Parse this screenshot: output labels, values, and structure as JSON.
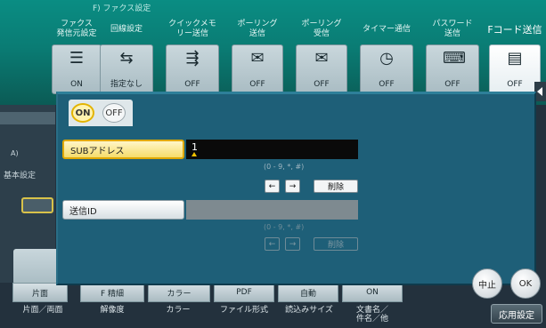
{
  "breadcrumb": "F) ファクス設定",
  "tabs": [
    {
      "label": "ファクス\n発信元設定",
      "value": "ON",
      "icon": "fax-header-icon",
      "active": false
    },
    {
      "label": "回線設定",
      "value": "指定なし",
      "icon": "line-icon",
      "active": false
    },
    {
      "label": "クイックメモ\nリー送信",
      "value": "OFF",
      "icon": "quick-memory-icon",
      "active": false
    },
    {
      "label": "ポーリング\n送信",
      "value": "OFF",
      "icon": "polling-send-icon",
      "active": false
    },
    {
      "label": "ポーリング\n受信",
      "value": "OFF",
      "icon": "polling-receive-icon",
      "active": false
    },
    {
      "label": "タイマー通信",
      "value": "OFF",
      "icon": "timer-icon",
      "active": false
    },
    {
      "label": "パスワード\n送信",
      "value": "OFF",
      "icon": "password-send-icon",
      "active": false
    },
    {
      "label": "Fコード送信",
      "value": "OFF",
      "icon": "f-code-icon",
      "active": true
    }
  ],
  "side": {
    "a_label": "A)",
    "kihon_label": "基本設定"
  },
  "toggle": {
    "on": "ON",
    "off": "OFF"
  },
  "sub_address": {
    "label": "SUBアドレス",
    "value": "1",
    "hint": "(0 - 9, *, #)",
    "delete": "削除"
  },
  "sender_id": {
    "label": "送信ID",
    "value": "",
    "hint": "(0 - 9, *, #)",
    "delete": "削除"
  },
  "arrows": {
    "left": "←",
    "right": "→"
  },
  "bottom_buttons": [
    "片面",
    "F 精細",
    "カラー",
    "PDF",
    "自動",
    "ON"
  ],
  "bottom_labels": [
    "片面／両面",
    "解像度",
    "カラー",
    "ファイル形式",
    "読込みサイズ",
    "文書名／\n件名／他"
  ],
  "actions": {
    "stop": "中止",
    "ok": "OK",
    "apply": "応用設定"
  },
  "colors": {
    "accent_yellow": "#f2c200",
    "panel": "#1e5f78",
    "header": "#0a8d83"
  }
}
